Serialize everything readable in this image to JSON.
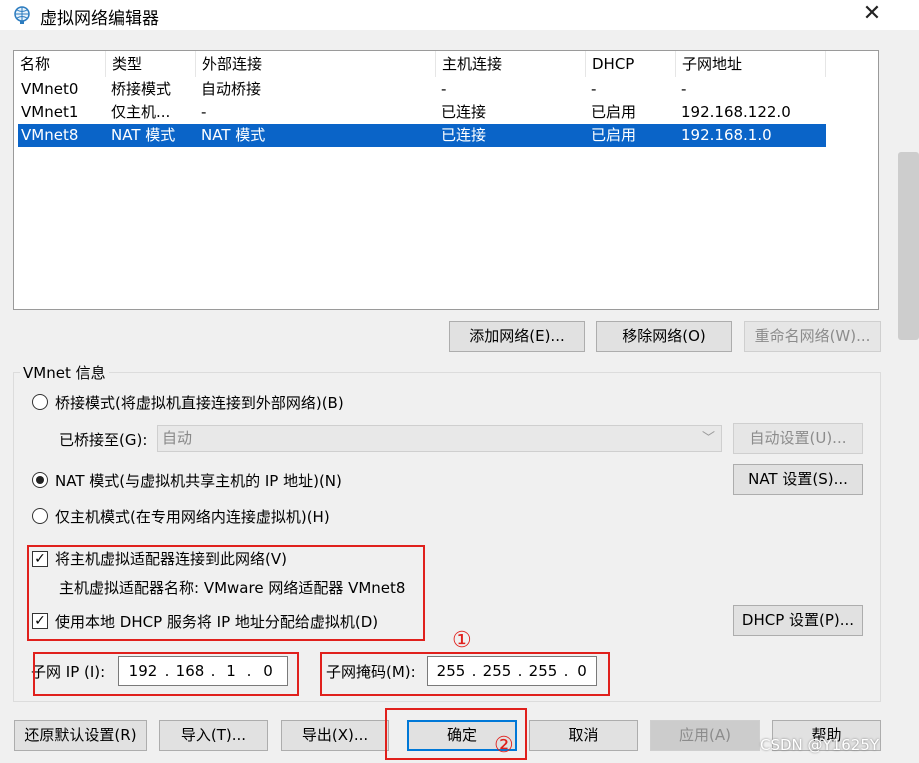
{
  "window": {
    "title": "虚拟网络编辑器",
    "close_glyph": "✕"
  },
  "table": {
    "columns": [
      "名称",
      "类型",
      "外部连接",
      "主机连接",
      "DHCP",
      "子网地址"
    ],
    "rows": [
      [
        "VMnet0",
        "桥接模式",
        "自动桥接",
        "-",
        "-",
        "-"
      ],
      [
        "VMnet1",
        "仅主机...",
        "-",
        "已连接",
        "已启用",
        "192.168.122.0"
      ],
      [
        "VMnet8",
        "NAT 模式",
        "NAT 模式",
        "已连接",
        "已启用",
        "192.168.1.0"
      ]
    ],
    "selected_row": 2
  },
  "list_buttons": {
    "add": "添加网络(E)...",
    "remove": "移除网络(O)",
    "rename": "重命名网络(W)..."
  },
  "vmnet_info": {
    "group_label": "VMnet 信息",
    "bridge_mode": "桥接模式(将虚拟机直接连接到外部网络)(B)",
    "bridged_to_label": "已桥接至(G):",
    "bridged_to_value": "自动",
    "auto_settings": "自动设置(U)...",
    "nat_mode": "NAT 模式(与虚拟机共享主机的 IP 地址)(N)",
    "nat_settings": "NAT 设置(S)...",
    "host_only": "仅主机模式(在专用网络内连接虚拟机)(H)",
    "connect_adapter": "将主机虚拟适配器连接到此网络(V)",
    "adapter_name": "主机虚拟适配器名称: VMware 网络适配器 VMnet8",
    "use_dhcp": "使用本地 DHCP 服务将 IP 地址分配给虚拟机(D)",
    "dhcp_settings": "DHCP 设置(P)...",
    "subnet_ip_label": "子网 IP (I):",
    "subnet_ip": [
      "192",
      "168",
      "1",
      "0"
    ],
    "subnet_mask_label": "子网掩码(M):",
    "subnet_mask": [
      "255",
      "255",
      "255",
      "0"
    ]
  },
  "bottom_buttons": {
    "restore": "还原默认设置(R)",
    "import": "导入(T)...",
    "export": "导出(X)...",
    "ok": "确定",
    "cancel": "取消",
    "apply": "应用(A)",
    "help": "帮助"
  },
  "annotations": {
    "marker1": "①",
    "marker2": "②"
  },
  "watermark": "CSDN @Y1625Y",
  "colors": {
    "selection": "#0a64c8",
    "annotation_red": "#e0201c",
    "default_button_border": "#0078d7"
  }
}
